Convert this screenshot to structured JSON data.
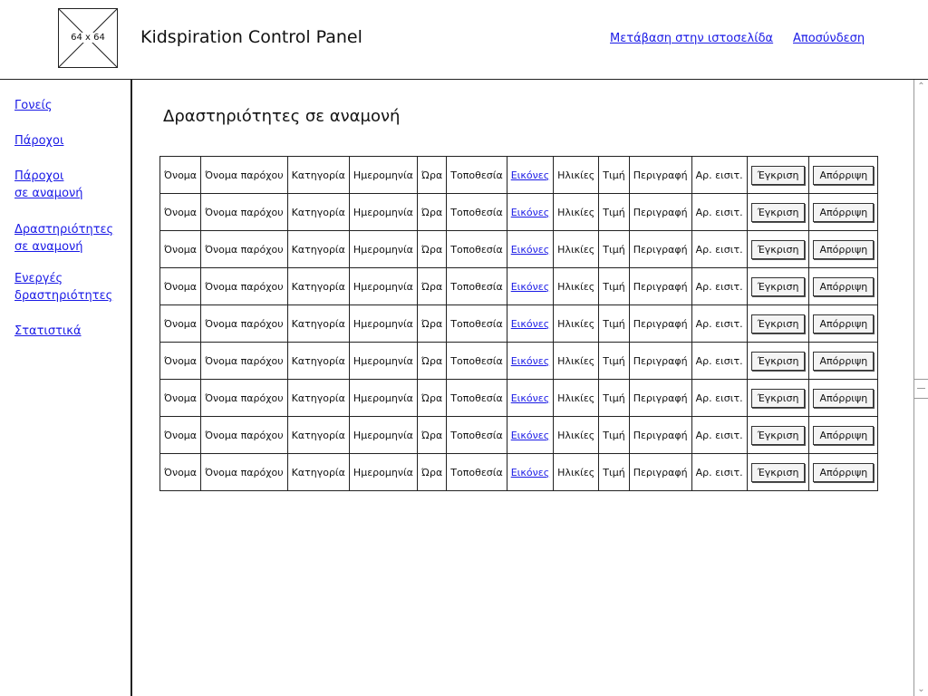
{
  "header": {
    "logo_label": "64 x 64",
    "title": "Kidspiration Control Panel",
    "link_site": "Μετάβαση στην ιστοσελίδα",
    "link_logout": "Αποσύνδεση"
  },
  "sidebar": {
    "items": [
      {
        "lines": [
          "Γονείς"
        ]
      },
      {
        "lines": [
          "Πάροχοι"
        ]
      },
      {
        "lines": [
          "Πάροχοι",
          "σε αναμονή"
        ]
      },
      {
        "lines": [
          "Δραστηριότητες",
          "σε αναμονή"
        ]
      },
      {
        "lines": [
          "Ενεργές",
          "δραστηριότητες"
        ]
      },
      {
        "lines": [
          "Στατιστικά"
        ]
      }
    ]
  },
  "main": {
    "title": "Δραστηριότητες σε αναμονή"
  },
  "table": {
    "rows": [
      {
        "name": "Όνομα",
        "provider": "Όνομα παρόχου",
        "category": "Κατηγορία",
        "date": "Ημερομηνία",
        "time": "Ώρα",
        "location": "Τοποθεσία",
        "images": "Εικόνες",
        "ages": "Ηλικίες",
        "price": "Τιμή",
        "description": "Περιγραφή",
        "tickets": "Αρ. εισιτ.",
        "approve": "Έγκριση",
        "reject": "Απόρριψη"
      },
      {
        "name": "Όνομα",
        "provider": "Όνομα παρόχου",
        "category": "Κατηγορία",
        "date": "Ημερομηνία",
        "time": "Ώρα",
        "location": "Τοποθεσία",
        "images": "Εικόνες",
        "ages": "Ηλικίες",
        "price": "Τιμή",
        "description": "Περιγραφή",
        "tickets": "Αρ. εισιτ.",
        "approve": "Έγκριση",
        "reject": "Απόρριψη"
      },
      {
        "name": "Όνομα",
        "provider": "Όνομα παρόχου",
        "category": "Κατηγορία",
        "date": "Ημερομηνία",
        "time": "Ώρα",
        "location": "Τοποθεσία",
        "images": "Εικόνες",
        "ages": "Ηλικίες",
        "price": "Τιμή",
        "description": "Περιγραφή",
        "tickets": "Αρ. εισιτ.",
        "approve": "Έγκριση",
        "reject": "Απόρριψη"
      },
      {
        "name": "Όνομα",
        "provider": "Όνομα παρόχου",
        "category": "Κατηγορία",
        "date": "Ημερομηνία",
        "time": "Ώρα",
        "location": "Τοποθεσία",
        "images": "Εικόνες",
        "ages": "Ηλικίες",
        "price": "Τιμή",
        "description": "Περιγραφή",
        "tickets": "Αρ. εισιτ.",
        "approve": "Έγκριση",
        "reject": "Απόρριψη"
      },
      {
        "name": "Όνομα",
        "provider": "Όνομα παρόχου",
        "category": "Κατηγορία",
        "date": "Ημερομηνία",
        "time": "Ώρα",
        "location": "Τοποθεσία",
        "images": "Εικόνες",
        "ages": "Ηλικίες",
        "price": "Τιμή",
        "description": "Περιγραφή",
        "tickets": "Αρ. εισιτ.",
        "approve": "Έγκριση",
        "reject": "Απόρριψη"
      },
      {
        "name": "Όνομα",
        "provider": "Όνομα παρόχου",
        "category": "Κατηγορία",
        "date": "Ημερομηνία",
        "time": "Ώρα",
        "location": "Τοποθεσία",
        "images": "Εικόνες",
        "ages": "Ηλικίες",
        "price": "Τιμή",
        "description": "Περιγραφή",
        "tickets": "Αρ. εισιτ.",
        "approve": "Έγκριση",
        "reject": "Απόρριψη"
      },
      {
        "name": "Όνομα",
        "provider": "Όνομα παρόχου",
        "category": "Κατηγορία",
        "date": "Ημερομηνία",
        "time": "Ώρα",
        "location": "Τοποθεσία",
        "images": "Εικόνες",
        "ages": "Ηλικίες",
        "price": "Τιμή",
        "description": "Περιγραφή",
        "tickets": "Αρ. εισιτ.",
        "approve": "Έγκριση",
        "reject": "Απόρριψη"
      },
      {
        "name": "Όνομα",
        "provider": "Όνομα παρόχου",
        "category": "Κατηγορία",
        "date": "Ημερομηνία",
        "time": "Ώρα",
        "location": "Τοποθεσία",
        "images": "Εικόνες",
        "ages": "Ηλικίες",
        "price": "Τιμή",
        "description": "Περιγραφή",
        "tickets": "Αρ. εισιτ.",
        "approve": "Έγκριση",
        "reject": "Απόρριψη"
      },
      {
        "name": "Όνομα",
        "provider": "Όνομα παρόχου",
        "category": "Κατηγορία",
        "date": "Ημερομηνία",
        "time": "Ώρα",
        "location": "Τοποθεσία",
        "images": "Εικόνες",
        "ages": "Ηλικίες",
        "price": "Τιμή",
        "description": "Περιγραφή",
        "tickets": "Αρ. εισιτ.",
        "approve": "Έγκριση",
        "reject": "Απόρριψη"
      }
    ]
  },
  "icons": {
    "logo": "image-placeholder-icon",
    "scroll_up": "scroll-up-arrow-icon",
    "scroll_down": "scroll-down-arrow-icon"
  }
}
